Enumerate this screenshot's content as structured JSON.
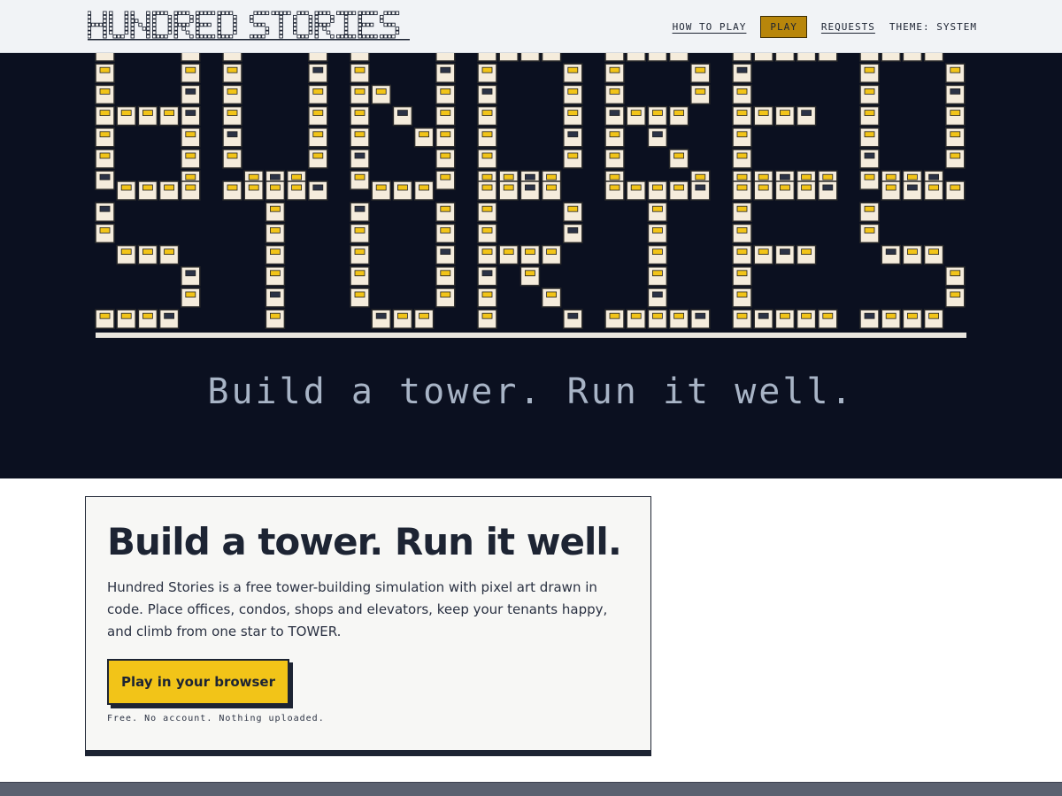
{
  "header": {
    "logo_text": "HUNDRED STORIES",
    "nav": {
      "how_to_play": "HOW TO PLAY",
      "play": "PLAY",
      "requests": "REQUESTS",
      "theme": "THEME: SYSTEM"
    }
  },
  "hero": {
    "banner_lines": [
      "HUNDRED",
      "STORIES"
    ],
    "tagline": "Build a tower. Run it well."
  },
  "card": {
    "title": "Build a tower. Run it well.",
    "description": "Hundred Stories is a free tower-building simulation with pixel art drawn in code. Place offices, condos, shops and elevators, keep your tenants happy, and climb from one star to TOWER.",
    "cta_label": "Play in your browser",
    "note": "Free. No account. Nothing uploaded."
  },
  "colors": {
    "hero_bg": "#0b1020",
    "window_frame": "#f5ecdc",
    "window_lit": "#f2c418",
    "window_dark": "#2b3245",
    "accent_play": "#b8860b",
    "cta": "#f2c418"
  }
}
